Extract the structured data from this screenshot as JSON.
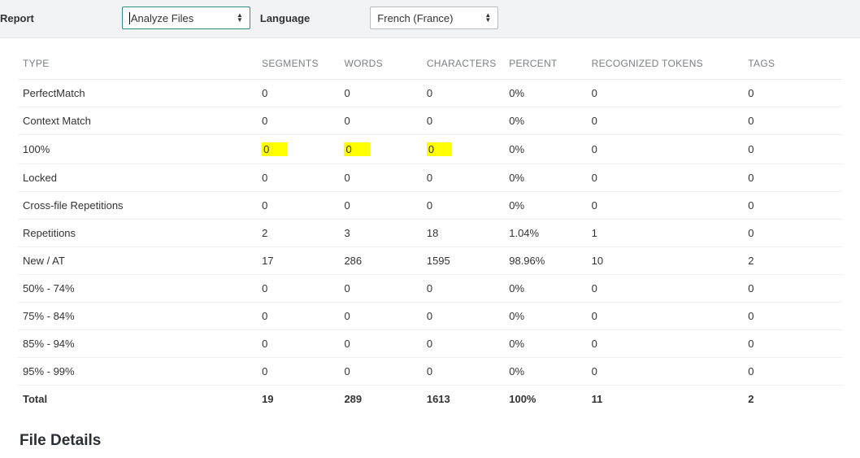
{
  "toolbar": {
    "report_label": "Report",
    "report_value": "Analyze Files",
    "language_label": "Language",
    "language_value": "French (France)"
  },
  "table": {
    "headers": {
      "type": "TYPE",
      "segments": "SEGMENTS",
      "words": "WORDS",
      "characters": "CHARACTERS",
      "percent": "PERCENT",
      "tokens": "RECOGNIZED TOKENS",
      "tags": "TAGS"
    },
    "rows": [
      {
        "type": "PerfectMatch",
        "segments": "0",
        "words": "0",
        "characters": "0",
        "percent": "0%",
        "tokens": "0",
        "tags": "0",
        "highlight": false
      },
      {
        "type": "Context Match",
        "segments": "0",
        "words": "0",
        "characters": "0",
        "percent": "0%",
        "tokens": "0",
        "tags": "0",
        "highlight": false
      },
      {
        "type": "100%",
        "segments": "0",
        "words": "0",
        "characters": "0",
        "percent": "0%",
        "tokens": "0",
        "tags": "0",
        "highlight": true
      },
      {
        "type": "Locked",
        "segments": "0",
        "words": "0",
        "characters": "0",
        "percent": "0%",
        "tokens": "0",
        "tags": "0",
        "highlight": false
      },
      {
        "type": "Cross-file Repetitions",
        "segments": "0",
        "words": "0",
        "characters": "0",
        "percent": "0%",
        "tokens": "0",
        "tags": "0",
        "highlight": false
      },
      {
        "type": "Repetitions",
        "segments": "2",
        "words": "3",
        "characters": "18",
        "percent": "1.04%",
        "tokens": "1",
        "tags": "0",
        "highlight": false
      },
      {
        "type": "New / AT",
        "segments": "17",
        "words": "286",
        "characters": "1595",
        "percent": "98.96%",
        "tokens": "10",
        "tags": "2",
        "highlight": false
      },
      {
        "type": "50% - 74%",
        "segments": "0",
        "words": "0",
        "characters": "0",
        "percent": "0%",
        "tokens": "0",
        "tags": "0",
        "highlight": false
      },
      {
        "type": "75% - 84%",
        "segments": "0",
        "words": "0",
        "characters": "0",
        "percent": "0%",
        "tokens": "0",
        "tags": "0",
        "highlight": false
      },
      {
        "type": "85% - 94%",
        "segments": "0",
        "words": "0",
        "characters": "0",
        "percent": "0%",
        "tokens": "0",
        "tags": "0",
        "highlight": false
      },
      {
        "type": "95% - 99%",
        "segments": "0",
        "words": "0",
        "characters": "0",
        "percent": "0%",
        "tokens": "0",
        "tags": "0",
        "highlight": false
      }
    ],
    "total": {
      "type": "Total",
      "segments": "19",
      "words": "289",
      "characters": "1613",
      "percent": "100%",
      "tokens": "11",
      "tags": "2"
    }
  },
  "section": {
    "file_details": "File Details"
  }
}
